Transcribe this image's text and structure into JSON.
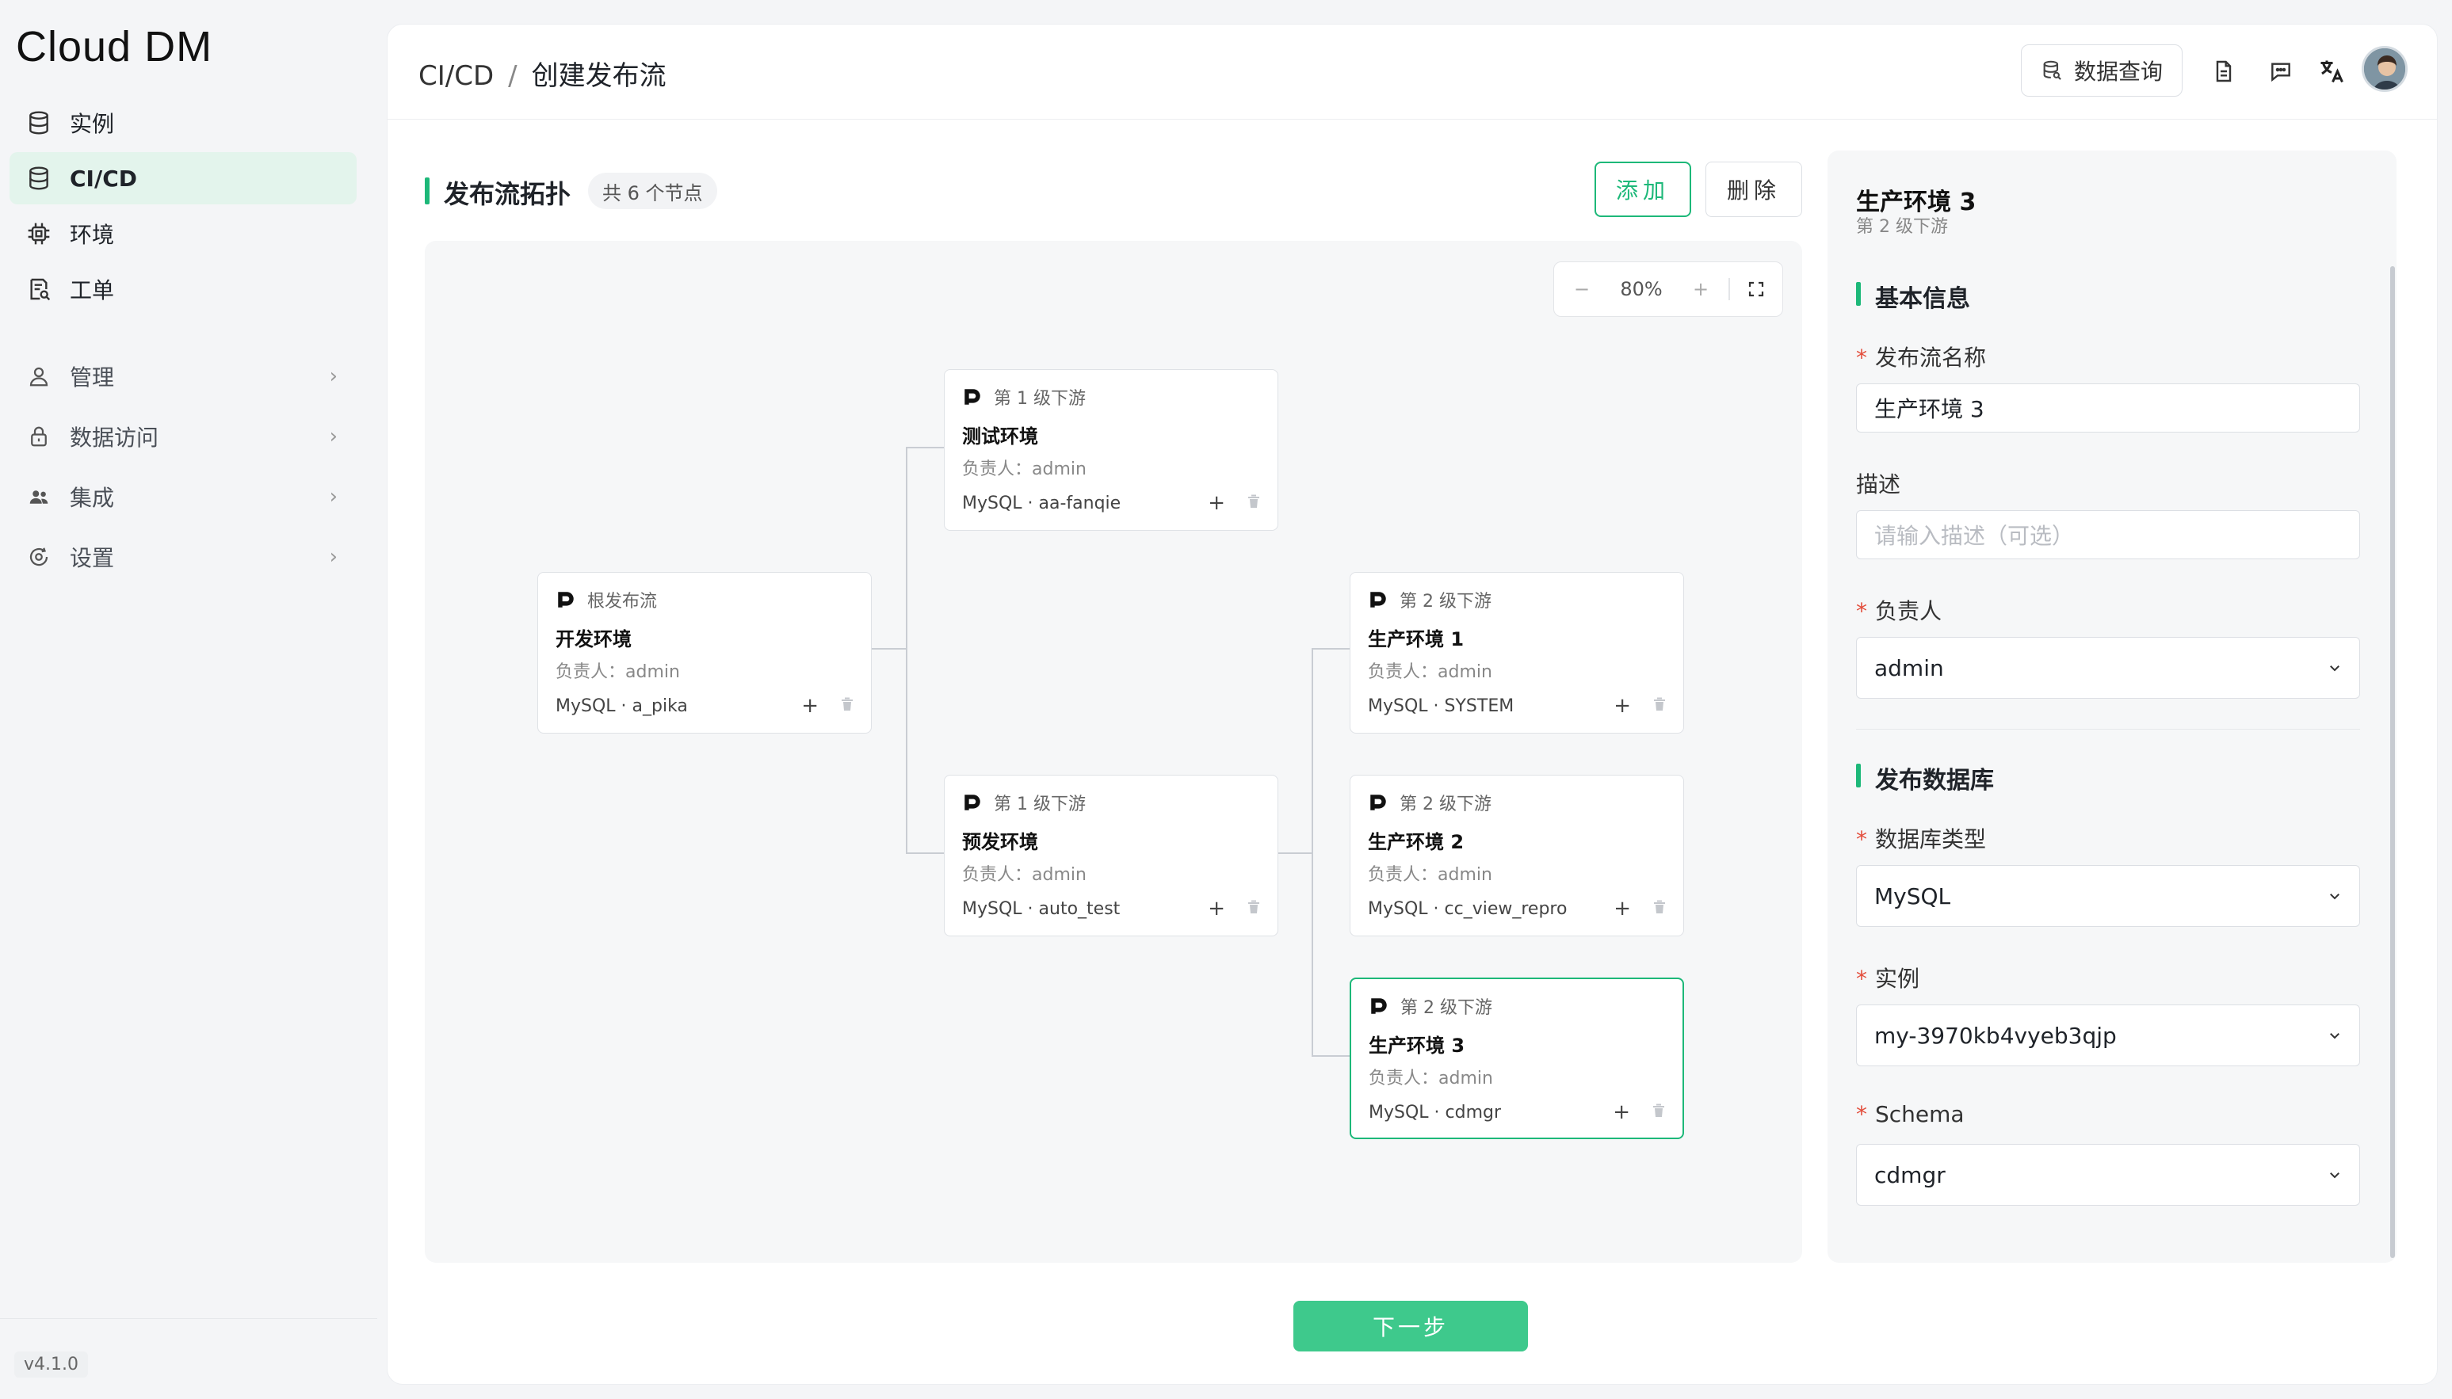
{
  "app": {
    "logo": "Cloud DM",
    "version": "v4.1.0"
  },
  "sidebar": {
    "items": [
      {
        "label": "实例",
        "icon": "database-icon"
      },
      {
        "label": "CI/CD",
        "icon": "database-stack-icon",
        "active": true
      },
      {
        "label": "环境",
        "icon": "chip-icon"
      },
      {
        "label": "工单",
        "icon": "ticket-icon"
      }
    ],
    "groups": [
      {
        "label": "管理",
        "icon": "user-icon"
      },
      {
        "label": "数据访问",
        "icon": "lock-icon"
      },
      {
        "label": "集成",
        "icon": "users-icon"
      },
      {
        "label": "设置",
        "icon": "settings-icon"
      }
    ]
  },
  "header": {
    "breadcrumb_parent": "CI/CD",
    "breadcrumb_sep": "/",
    "breadcrumb_current": "创建发布流",
    "query_button": "数据查询"
  },
  "topology": {
    "title": "发布流拓扑",
    "count": "共 6 个节点",
    "add": "添加",
    "delete": "删除",
    "zoom": "80%",
    "zoom_minus": "−",
    "zoom_plus": "+",
    "owner_prefix": "负责人：",
    "nodes": [
      {
        "level": "根发布流",
        "name": "开发环境",
        "owner": "admin",
        "db": "MySQL · a_pika"
      },
      {
        "level": "第 1 级下游",
        "name": "测试环境",
        "owner": "admin",
        "db": "MySQL · aa-fanqie"
      },
      {
        "level": "第 1 级下游",
        "name": "预发环境",
        "owner": "admin",
        "db": "MySQL · auto_test"
      },
      {
        "level": "第 2 级下游",
        "name": "生产环境 1",
        "owner": "admin",
        "db": "MySQL · SYSTEM"
      },
      {
        "level": "第 2 级下游",
        "name": "生产环境 2",
        "owner": "admin",
        "db": "MySQL · cc_view_repro"
      },
      {
        "level": "第 2 级下游",
        "name": "生产环境 3",
        "owner": "admin",
        "db": "MySQL · cdmgr",
        "selected": true
      }
    ]
  },
  "panel": {
    "title": "生产环境 3",
    "subtitle": "第 2 级下游",
    "basic_section": "基本信息",
    "name_label": "发布流名称",
    "name_value": "生产环境 3",
    "desc_label": "描述",
    "desc_placeholder": "请输入描述（可选）",
    "owner_label": "负责人",
    "owner_value": "admin",
    "db_section": "发布数据库",
    "dbtype_label": "数据库类型",
    "dbtype_value": "MySQL",
    "instance_label": "实例",
    "instance_value": "my-3970kb4vyeb3qjp",
    "schema_label": "Schema",
    "schema_value": "cdmgr",
    "required_mark": "*"
  },
  "footer": {
    "next": "下一步"
  },
  "colors": {
    "accent": "#1db879",
    "next": "#3ec98c",
    "active_bg": "#e3f4ec"
  }
}
